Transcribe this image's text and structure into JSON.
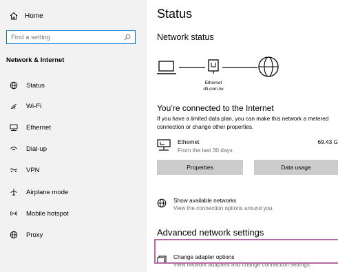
{
  "sidebar": {
    "home_label": "Home",
    "search_placeholder": "Find a setting",
    "section_title": "Network & Internet",
    "items": [
      {
        "label": "Status",
        "icon": "globe-status-icon"
      },
      {
        "label": "Wi-Fi",
        "icon": "wifi-icon"
      },
      {
        "label": "Ethernet",
        "icon": "ethernet-icon"
      },
      {
        "label": "Dial-up",
        "icon": "dialup-icon"
      },
      {
        "label": "VPN",
        "icon": "vpn-icon"
      },
      {
        "label": "Airplane mode",
        "icon": "airplane-icon"
      },
      {
        "label": "Mobile hotspot",
        "icon": "hotspot-icon"
      },
      {
        "label": "Proxy",
        "icon": "proxy-globe-icon"
      }
    ]
  },
  "main": {
    "title": "Status",
    "network_status_heading": "Network status",
    "diagram": {
      "adapter_label": "Ethernet",
      "network_label": "dfi.com.tw"
    },
    "connected_title": "You’re connected to the Internet",
    "connected_desc": "If you have a limited data plan, you can make this network a metered connection or change other properties.",
    "ethernet": {
      "name": "Ethernet",
      "subtitle": "From the last 30 days",
      "usage": "69.43 G"
    },
    "buttons": {
      "properties": "Properties",
      "data_usage": "Data usage"
    },
    "show_networks": {
      "title": "Show available networks",
      "desc": "View the connection options around you."
    },
    "advanced_heading": "Advanced network settings",
    "change_adapter": {
      "title": "Change adapter options",
      "desc": "View network adapters and change connection settings."
    }
  },
  "colors": {
    "accent": "#0078d7",
    "sidebar_bg": "#f2f2f2",
    "button_bg": "#cccccc",
    "highlight": "#b866a8",
    "secondary_text": "#6b6b6b"
  }
}
